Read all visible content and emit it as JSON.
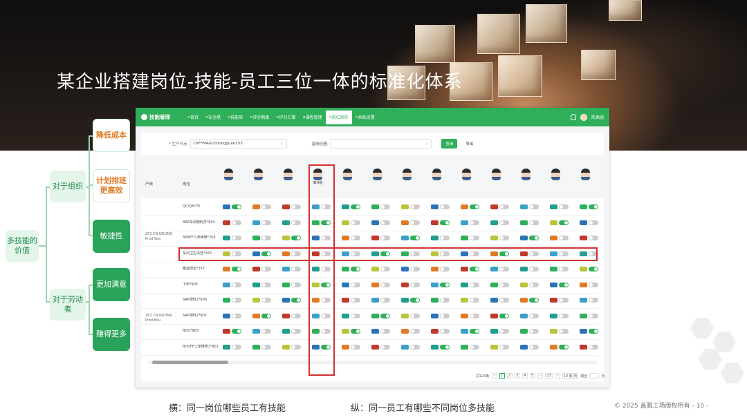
{
  "slide": {
    "title": "某企业搭建岗位-技能-员工三位一体的标准化体系",
    "caption_horizontal": "横：同一岗位哪些员工有技能",
    "caption_vertical": "纵：同一员工有哪些不同岗位多技能",
    "copyright": "© 2025  盖雅工场版权所有  - 10 -"
  },
  "mindmap": {
    "root": "多技能的价值",
    "branch_org": "对于组织",
    "branch_labor": "对于劳动者",
    "leaf_cost": "降低成本",
    "leaf_schedule": "计划排班更高效",
    "leaf_agile": "敏捷性",
    "leaf_satisfied": "更加满意",
    "leaf_earn": "赚得更多"
  },
  "app": {
    "brand": "技能管理",
    "nav": [
      "首页",
      "安全塔",
      "技能库",
      "评分制度",
      "评分方案",
      "课程管理",
      "岗位矩阵",
      "系统设置"
    ],
    "active_nav_index": 6,
    "user": "陈佩涵",
    "filter": {
      "org_label": "* 生产节点",
      "org_value": "CN**MAGO/Dongguan253",
      "manager_label": "直线经理:",
      "manager_value": "",
      "query_button": "查询",
      "export_button": "导出"
    },
    "table": {
      "col_line": "产线",
      "col_post": "岗位",
      "highlighted_employee": "覃涛程",
      "groups": [
        "253 CN NDUMG Prod Sea",
        "263 CN NDUMG Prod Bou"
      ],
      "posts": [
        "QC/QA*75",
        "SEA车间物料员*904",
        "SEAFF工单维修*256",
        "车间卫生清洁*155",
        "搬运岗位*257",
        "下料*905",
        "SAP领料1*906",
        "SAP领料2*902",
        "BOU*903",
        "BOUFF工单维修1*901"
      ]
    },
    "pager": {
      "total": "共124条",
      "pages": [
        "1",
        "2",
        "3",
        "4",
        "5",
        "···",
        "13"
      ],
      "current": "1",
      "page_size": "10 条/页",
      "goto": "跳至",
      "page_word": "页"
    }
  }
}
